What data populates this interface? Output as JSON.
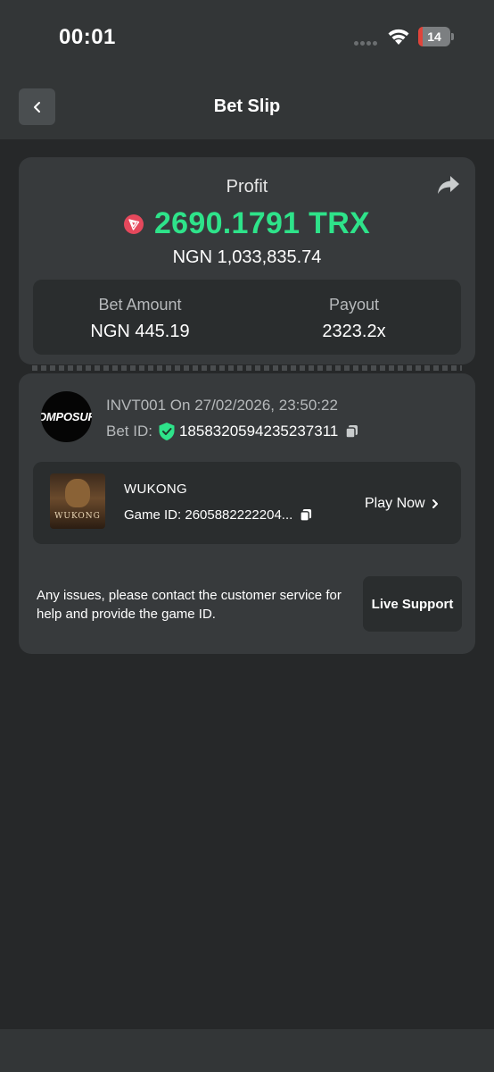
{
  "status_bar": {
    "time": "00:01",
    "battery_level": "14",
    "battery_fraction": 0.14,
    "battery_color": "#e0443a"
  },
  "header": {
    "title": "Bet Slip",
    "back_icon": "chevron-left-icon"
  },
  "profit_card": {
    "label": "Profit",
    "amount": "2690.1791 TRX",
    "amount_color": "#2ee38a",
    "currency_icon": "tron-icon",
    "fiat_amount": "NGN 1,033,835.74",
    "share_icon": "share-icon",
    "bet_amount_label": "Bet Amount",
    "bet_amount_value": "NGN 445.19",
    "payout_label": "Payout",
    "payout_value": "2323.2x"
  },
  "bet_card": {
    "avatar_text": "COMPOSURE",
    "user_line": "INVT001 On 27/02/2026, 23:50:22",
    "bet_id_label": "Bet ID:",
    "bet_id_value": "1858320594235237311",
    "verified_icon": "verified-shield-icon",
    "copy_icon": "copy-icon",
    "game": {
      "thumb_text": "WUKONG",
      "title": "WUKONG",
      "game_id": "Game ID: 2605882222204...",
      "play_now": "Play Now"
    },
    "support_text": "Any issues, please contact the customer service for help and provide the game ID.",
    "live_support": "Live Support"
  }
}
